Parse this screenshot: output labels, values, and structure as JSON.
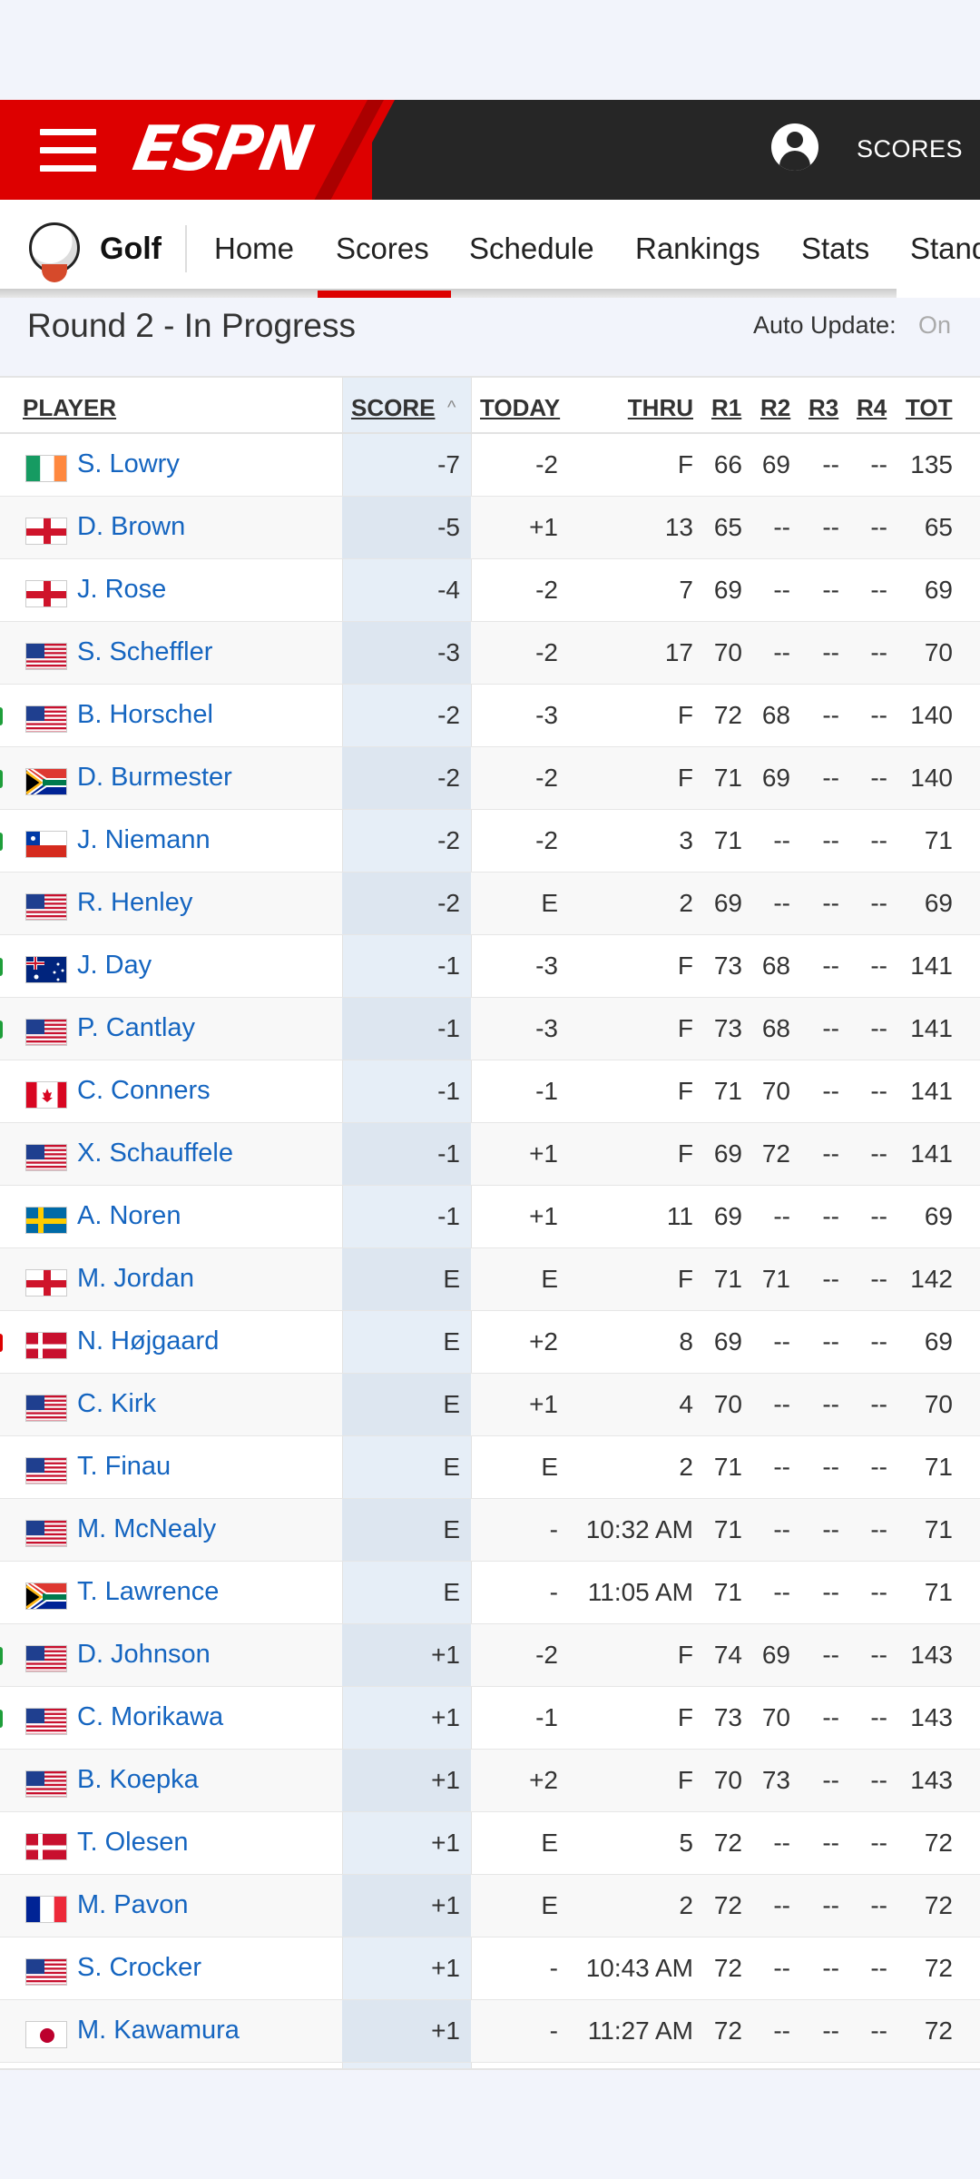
{
  "header": {
    "logo": "ESPN",
    "scores_link": "SCORES",
    "icons": [
      "hamburger-menu-icon",
      "user-profile-icon"
    ],
    "colors": {
      "brand_red": "#dd0000",
      "bar_dark": "#262626",
      "link_blue": "#1565c0"
    }
  },
  "sport_nav": {
    "sport": "Golf",
    "items": [
      "Home",
      "Scores",
      "Schedule",
      "Rankings",
      "Stats",
      "Stand"
    ],
    "active": "Scores"
  },
  "round": {
    "status": "Round 2 - In Progress",
    "auto_update_label": "Auto Update:",
    "auto_update_value": "On"
  },
  "table": {
    "headers": [
      "PLAYER",
      "SCORE",
      "TODAY",
      "THRU",
      "R1",
      "R2",
      "R3",
      "R4",
      "TOT"
    ],
    "sorted_by": "SCORE",
    "rows": [
      {
        "flag": "ireland",
        "player": "S. Lowry",
        "score": "-7",
        "today": "-2",
        "thru": "F",
        "r1": "66",
        "r2": "69",
        "r3": "--",
        "r4": "--",
        "tot": "135"
      },
      {
        "flag": "england",
        "player": "D. Brown",
        "score": "-5",
        "today": "+1",
        "thru": "13",
        "r1": "65",
        "r2": "--",
        "r3": "--",
        "r4": "--",
        "tot": "65"
      },
      {
        "flag": "england",
        "player": "J. Rose",
        "score": "-4",
        "today": "-2",
        "thru": "7",
        "r1": "69",
        "r2": "--",
        "r3": "--",
        "r4": "--",
        "tot": "69"
      },
      {
        "flag": "usa",
        "player": "S. Scheffler",
        "score": "-3",
        "today": "-2",
        "thru": "17",
        "r1": "70",
        "r2": "--",
        "r3": "--",
        "r4": "--",
        "tot": "70"
      },
      {
        "flag": "usa",
        "player": "B. Horschel",
        "score": "-2",
        "today": "-3",
        "thru": "F",
        "r1": "72",
        "r2": "68",
        "r3": "--",
        "r4": "--",
        "tot": "140"
      },
      {
        "flag": "south-africa",
        "player": "D. Burmester",
        "score": "-2",
        "today": "-2",
        "thru": "F",
        "r1": "71",
        "r2": "69",
        "r3": "--",
        "r4": "--",
        "tot": "140"
      },
      {
        "flag": "chile",
        "player": "J. Niemann",
        "score": "-2",
        "today": "-2",
        "thru": "3",
        "r1": "71",
        "r2": "--",
        "r3": "--",
        "r4": "--",
        "tot": "71"
      },
      {
        "flag": "usa",
        "player": "R. Henley",
        "score": "-2",
        "today": "E",
        "thru": "2",
        "r1": "69",
        "r2": "--",
        "r3": "--",
        "r4": "--",
        "tot": "69"
      },
      {
        "flag": "australia",
        "player": "J. Day",
        "score": "-1",
        "today": "-3",
        "thru": "F",
        "r1": "73",
        "r2": "68",
        "r3": "--",
        "r4": "--",
        "tot": "141"
      },
      {
        "flag": "usa",
        "player": "P. Cantlay",
        "score": "-1",
        "today": "-3",
        "thru": "F",
        "r1": "73",
        "r2": "68",
        "r3": "--",
        "r4": "--",
        "tot": "141"
      },
      {
        "flag": "canada",
        "player": "C. Conners",
        "score": "-1",
        "today": "-1",
        "thru": "F",
        "r1": "71",
        "r2": "70",
        "r3": "--",
        "r4": "--",
        "tot": "141"
      },
      {
        "flag": "usa",
        "player": "X. Schauffele",
        "score": "-1",
        "today": "+1",
        "thru": "F",
        "r1": "69",
        "r2": "72",
        "r3": "--",
        "r4": "--",
        "tot": "141"
      },
      {
        "flag": "sweden",
        "player": "A. Noren",
        "score": "-1",
        "today": "+1",
        "thru": "11",
        "r1": "69",
        "r2": "--",
        "r3": "--",
        "r4": "--",
        "tot": "69"
      },
      {
        "flag": "england",
        "player": "M. Jordan",
        "score": "E",
        "today": "E",
        "thru": "F",
        "r1": "71",
        "r2": "71",
        "r3": "--",
        "r4": "--",
        "tot": "142"
      },
      {
        "flag": "denmark",
        "player": "N. Højgaard",
        "score": "E",
        "today": "+2",
        "thru": "8",
        "r1": "69",
        "r2": "--",
        "r3": "--",
        "r4": "--",
        "tot": "69"
      },
      {
        "flag": "usa",
        "player": "C. Kirk",
        "score": "E",
        "today": "+1",
        "thru": "4",
        "r1": "70",
        "r2": "--",
        "r3": "--",
        "r4": "--",
        "tot": "70"
      },
      {
        "flag": "usa",
        "player": "T. Finau",
        "score": "E",
        "today": "E",
        "thru": "2",
        "r1": "71",
        "r2": "--",
        "r3": "--",
        "r4": "--",
        "tot": "71"
      },
      {
        "flag": "usa",
        "player": "M. McNealy",
        "score": "E",
        "today": "-",
        "thru": "10:32 AM",
        "r1": "71",
        "r2": "--",
        "r3": "--",
        "r4": "--",
        "tot": "71"
      },
      {
        "flag": "south-africa",
        "player": "T. Lawrence",
        "score": "E",
        "today": "-",
        "thru": "11:05 AM",
        "r1": "71",
        "r2": "--",
        "r3": "--",
        "r4": "--",
        "tot": "71"
      },
      {
        "flag": "usa",
        "player": "D. Johnson",
        "score": "+1",
        "today": "-2",
        "thru": "F",
        "r1": "74",
        "r2": "69",
        "r3": "--",
        "r4": "--",
        "tot": "143"
      },
      {
        "flag": "usa",
        "player": "C. Morikawa",
        "score": "+1",
        "today": "-1",
        "thru": "F",
        "r1": "73",
        "r2": "70",
        "r3": "--",
        "r4": "--",
        "tot": "143"
      },
      {
        "flag": "usa",
        "player": "B. Koepka",
        "score": "+1",
        "today": "+2",
        "thru": "F",
        "r1": "70",
        "r2": "73",
        "r3": "--",
        "r4": "--",
        "tot": "143"
      },
      {
        "flag": "denmark",
        "player": "T. Olesen",
        "score": "+1",
        "today": "E",
        "thru": "5",
        "r1": "72",
        "r2": "--",
        "r3": "--",
        "r4": "--",
        "tot": "72"
      },
      {
        "flag": "france",
        "player": "M. Pavon",
        "score": "+1",
        "today": "E",
        "thru": "2",
        "r1": "72",
        "r2": "--",
        "r3": "--",
        "r4": "--",
        "tot": "72"
      },
      {
        "flag": "usa",
        "player": "S. Crocker",
        "score": "+1",
        "today": "-",
        "thru": "10:43 AM",
        "r1": "72",
        "r2": "--",
        "r3": "--",
        "r4": "--",
        "tot": "72"
      },
      {
        "flag": "japan",
        "player": "M. Kawamura",
        "score": "+1",
        "today": "-",
        "thru": "11:27 AM",
        "r1": "72",
        "r2": "--",
        "r3": "--",
        "r4": "--",
        "tot": "72"
      }
    ]
  }
}
